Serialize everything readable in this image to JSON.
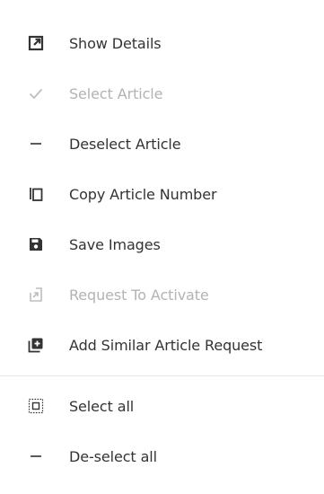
{
  "menu": {
    "items": [
      {
        "label": "Show Details",
        "icon": "open-external-icon",
        "enabled": true
      },
      {
        "label": "Select Article",
        "icon": "checkmark-icon",
        "enabled": false
      },
      {
        "label": "Deselect Article",
        "icon": "minus-icon",
        "enabled": true
      },
      {
        "label": "Copy Article Number",
        "icon": "copy-icon",
        "enabled": true
      },
      {
        "label": "Save Images",
        "icon": "save-icon",
        "enabled": true
      },
      {
        "label": "Request To Activate",
        "icon": "request-activate-icon",
        "enabled": false
      },
      {
        "label": "Add Similar Article Request",
        "icon": "add-box-icon",
        "enabled": true
      }
    ],
    "group2": [
      {
        "label": "Select all",
        "icon": "select-all-icon",
        "enabled": true
      },
      {
        "label": "De-select all",
        "icon": "minus-icon",
        "enabled": true
      }
    ]
  },
  "colors": {
    "text": "#333333",
    "disabled_text": "#b3b3b3",
    "icon": "#333333",
    "disabled_icon": "#bdbdbd",
    "divider": "#e6e6e6",
    "background": "#ffffff"
  }
}
